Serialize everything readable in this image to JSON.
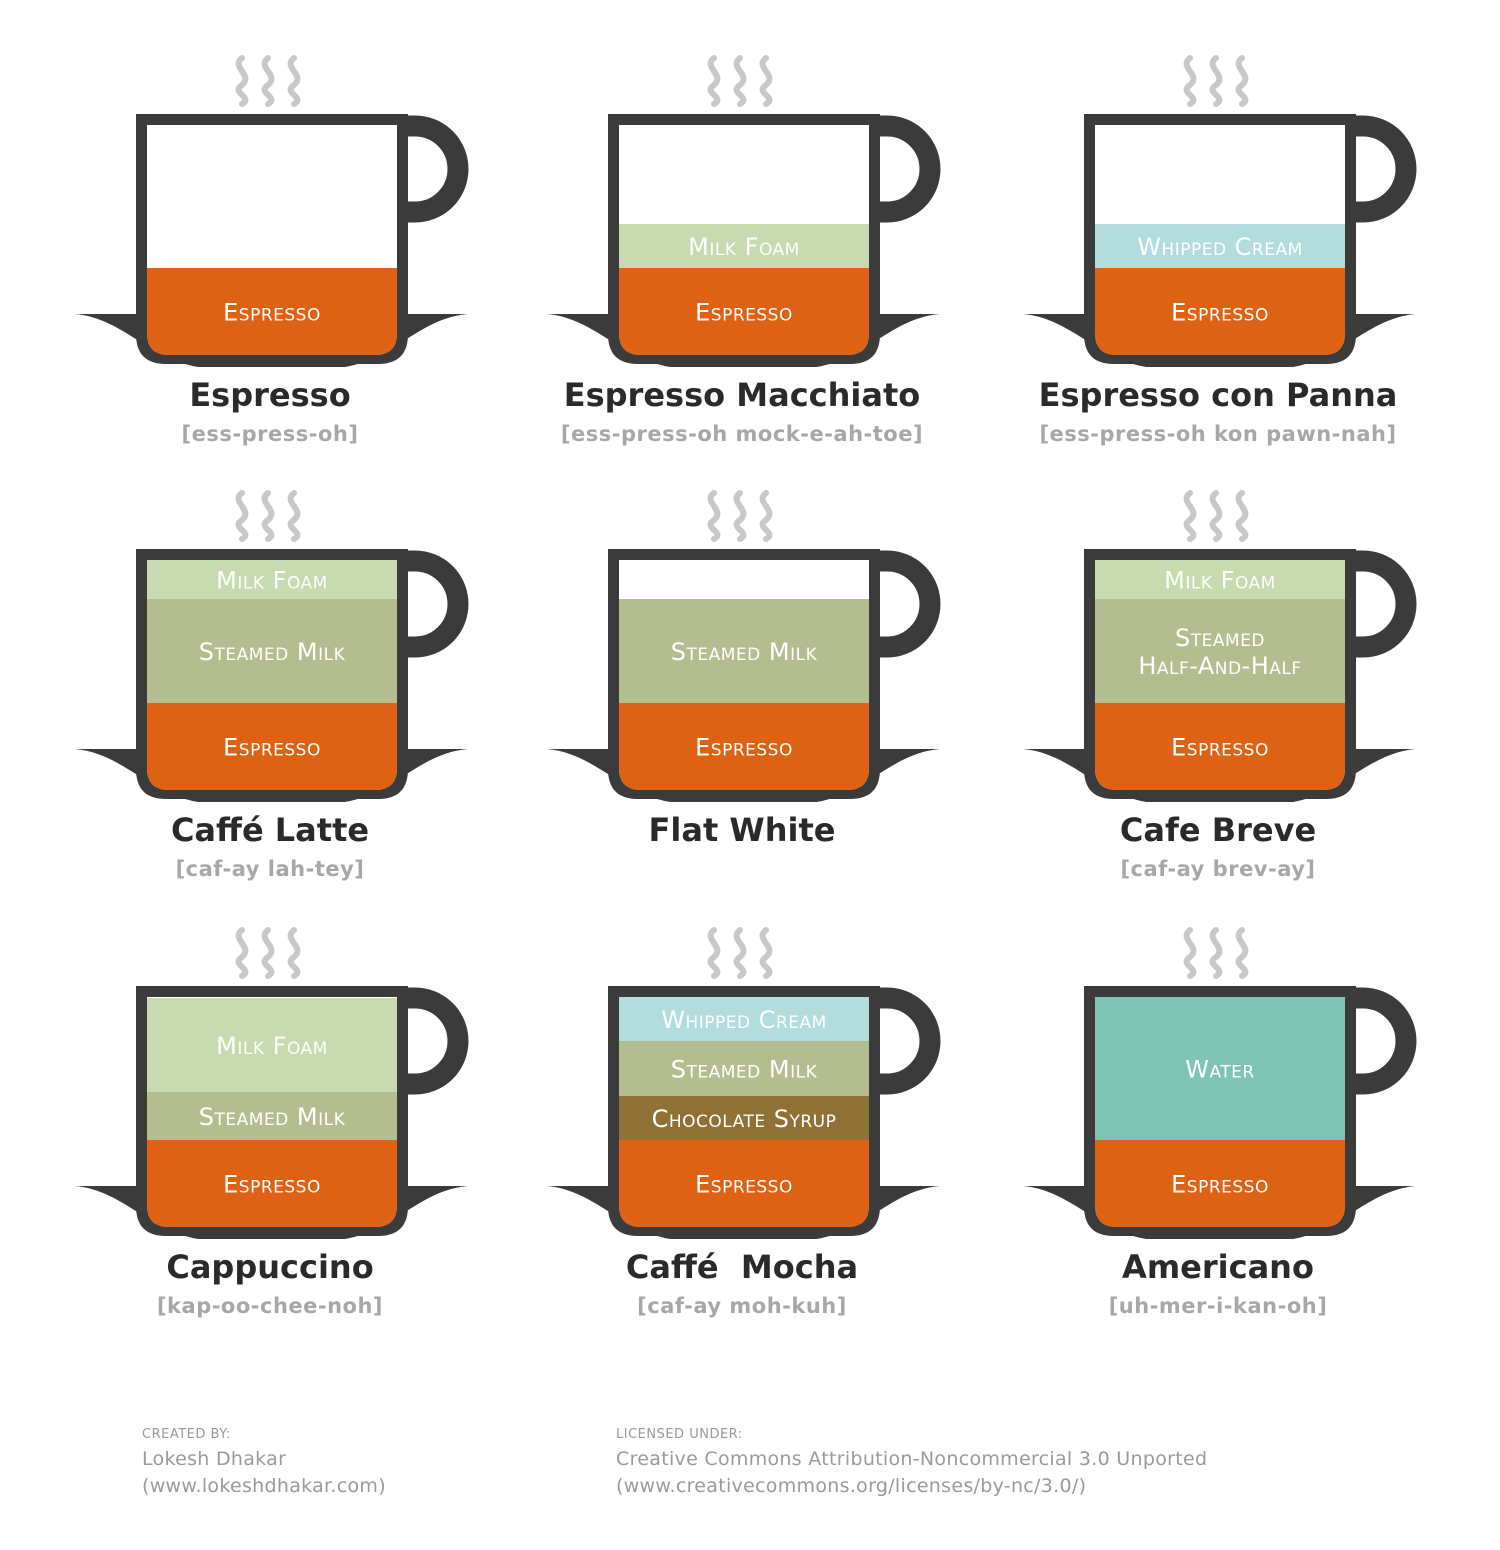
{
  "colors": {
    "cup": "#3b3b3b",
    "espresso": "#de6214",
    "milk_foam": "#c8dab0",
    "steamed_milk": "#b4bd8f",
    "whipped_cream": "#b3dcdc",
    "chocolate_syrup": "#8f7035",
    "water": "#7fc3b5",
    "steam": "#c8c8c8"
  },
  "drinks": [
    {
      "name": "Espresso",
      "pronunciation": "[ess-press-oh]",
      "layers": [
        {
          "label": "Espresso",
          "type": "espresso",
          "fraction": 0.38
        }
      ]
    },
    {
      "name": "Espresso Macchiato",
      "pronunciation": "[ess-press-oh mock-e-ah-toe]",
      "layers": [
        {
          "label": "Espresso",
          "type": "espresso",
          "fraction": 0.38
        },
        {
          "label": "Milk Foam",
          "type": "milk_foam",
          "fraction": 0.19
        }
      ]
    },
    {
      "name": "Espresso con Panna",
      "pronunciation": "[ess-press-oh kon pawn-nah]",
      "layers": [
        {
          "label": "Espresso",
          "type": "espresso",
          "fraction": 0.38
        },
        {
          "label": "Whipped Cream",
          "type": "whipped_cream",
          "fraction": 0.19
        }
      ]
    },
    {
      "name": "Caffé Latte",
      "pronunciation": "[caf-ay lah-tey]",
      "layers": [
        {
          "label": "Espresso",
          "type": "espresso",
          "fraction": 0.38
        },
        {
          "label": "Steamed Milk",
          "type": "steamed_milk",
          "fraction": 0.45
        },
        {
          "label": "Milk Foam",
          "type": "milk_foam",
          "fraction": 0.17
        }
      ]
    },
    {
      "name": "Flat White",
      "pronunciation": "",
      "layers": [
        {
          "label": "Espresso",
          "type": "espresso",
          "fraction": 0.38
        },
        {
          "label": "Steamed Milk",
          "type": "steamed_milk",
          "fraction": 0.45
        }
      ]
    },
    {
      "name": "Cafe Breve",
      "pronunciation": "[caf-ay brev-ay]",
      "layers": [
        {
          "label": "Espresso",
          "type": "espresso",
          "fraction": 0.38
        },
        {
          "label": "Steamed Half-And-Half",
          "label_lines": [
            "Steamed",
            "Half-And-Half"
          ],
          "type": "steamed_milk",
          "fraction": 0.45
        },
        {
          "label": "Milk Foam",
          "type": "milk_foam",
          "fraction": 0.17
        }
      ]
    },
    {
      "name": "Cappuccino",
      "pronunciation": "[kap-oo-chee-noh]",
      "layers": [
        {
          "label": "Espresso",
          "type": "espresso",
          "fraction": 0.38
        },
        {
          "label": "Steamed Milk",
          "type": "steamed_milk",
          "fraction": 0.21
        },
        {
          "label": "Milk Foam",
          "type": "milk_foam",
          "fraction": 0.41
        }
      ]
    },
    {
      "name": "Caffé  Mocha",
      "pronunciation": "[caf-ay moh-kuh]",
      "layers": [
        {
          "label": "Espresso",
          "type": "espresso",
          "fraction": 0.38
        },
        {
          "label": "Chocolate Syrup",
          "type": "chocolate_syrup",
          "fraction": 0.19
        },
        {
          "label": "Steamed Milk",
          "type": "steamed_milk",
          "fraction": 0.24
        },
        {
          "label": "Whipped Cream",
          "type": "whipped_cream",
          "fraction": 0.19
        }
      ]
    },
    {
      "name": "Americano",
      "pronunciation": "[uh-mer-i-kan-oh]",
      "layers": [
        {
          "label": "Espresso",
          "type": "espresso",
          "fraction": 0.38
        },
        {
          "label": "Water",
          "type": "water",
          "fraction": 0.62
        }
      ]
    }
  ],
  "credits": {
    "created_caption": "CREATED BY:",
    "author": "Lokesh Dhakar",
    "author_url": "(www.lokeshdhakar.com)",
    "license_caption": "LICENSED UNDER:",
    "license": "Creative Commons Attribution-Noncommercial 3.0 Unported",
    "license_url": "(www.creativecommons.org/licenses/by-nc/3.0/)"
  }
}
